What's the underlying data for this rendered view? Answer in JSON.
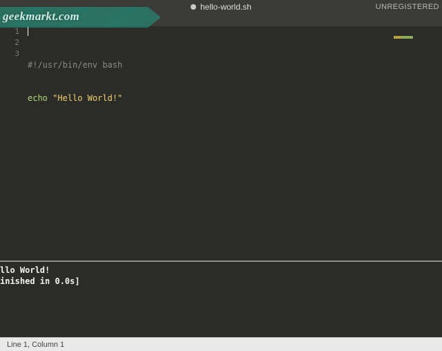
{
  "tab": {
    "filename": "hello-world.sh",
    "unregistered": "UNREGISTERED"
  },
  "editor": {
    "lines": {
      "l1_comment": "#!/usr/bin/env bash",
      "l2_keyword": "echo",
      "l2_space": " ",
      "l2_string": "\"Hello World!\""
    },
    "line_numbers": {
      "n1": "1",
      "n2": "2",
      "n3": "3"
    }
  },
  "output": {
    "line1": "llo World!",
    "line2": "inished in 0.0s]"
  },
  "status": {
    "position": "Line 1, Column 1"
  },
  "watermark": {
    "text": "geekmarkt.com"
  }
}
